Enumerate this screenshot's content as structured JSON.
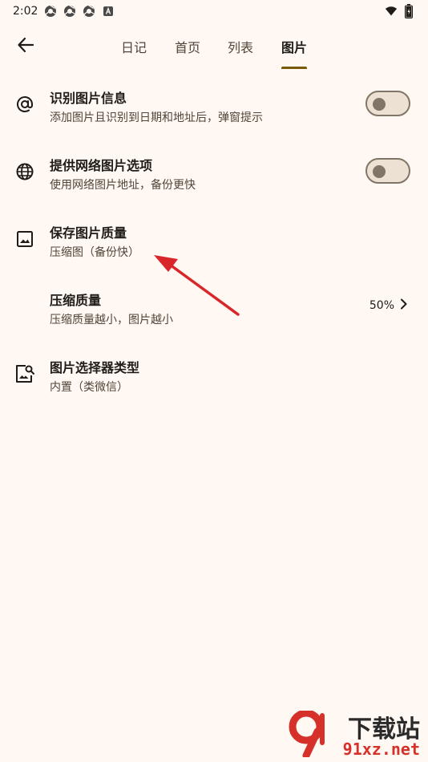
{
  "status_bar": {
    "time": "2:02",
    "notification_icons": [
      "chrome-icon",
      "chrome-icon",
      "chrome-icon",
      "notification-a-icon"
    ],
    "right_icons": [
      "wifi-icon",
      "battery-icon"
    ]
  },
  "top_bar": {
    "back_icon": "arrow-left-icon",
    "tabs": [
      {
        "label": "日记",
        "active": false
      },
      {
        "label": "首页",
        "active": false
      },
      {
        "label": "列表",
        "active": false
      },
      {
        "label": "图片",
        "active": true
      }
    ]
  },
  "settings": [
    {
      "icon": "at-sign-icon",
      "title": "识别图片信息",
      "subtitle": "添加图片且识别到日期和地址后，弹窗提示",
      "control": "switch",
      "checked": false
    },
    {
      "icon": "globe-icon",
      "title": "提供网络图片选项",
      "subtitle": "使用网络图片地址，备份更快",
      "control": "switch",
      "checked": false
    },
    {
      "icon": "image-icon",
      "title": "保存图片质量",
      "subtitle": "压缩图（备份快）"
    },
    {
      "title": "压缩质量",
      "subtitle": "压缩质量越小，图片越小",
      "value": "50%",
      "value_icon": "chevron-right-icon"
    },
    {
      "icon": "image-search-icon",
      "title": "图片选择器类型",
      "subtitle": "内置（类微信）"
    }
  ],
  "colors": {
    "background": "#fff8f3",
    "accent": "#7a5900",
    "annotation_arrow": "#d8262a"
  },
  "watermark": {
    "top": "下载站",
    "bottom": "91xz.net"
  }
}
